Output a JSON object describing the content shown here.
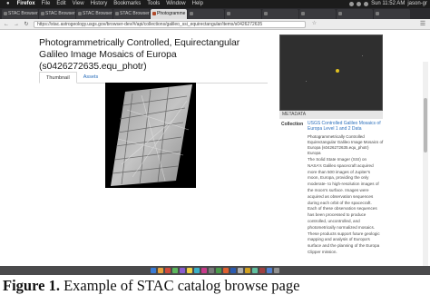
{
  "menubar": {
    "app_name": "Firefox",
    "items": [
      "File",
      "Edit",
      "View",
      "History",
      "Bookmarks",
      "Tools",
      "Window",
      "Help"
    ],
    "clock": "Sun 11:52 AM",
    "user": "jason-gr"
  },
  "browser_tabs": [
    {
      "label": "STAC Browser",
      "active": false
    },
    {
      "label": "STAC Browser",
      "active": false
    },
    {
      "label": "STAC Browser",
      "active": false
    },
    {
      "label": "STAC Browser",
      "active": false
    },
    {
      "label": "Photogramme",
      "active": true
    },
    {
      "label": "",
      "active": false
    },
    {
      "label": "",
      "active": false
    },
    {
      "label": "",
      "active": false
    },
    {
      "label": "",
      "active": false
    },
    {
      "label": "",
      "active": false
    },
    {
      "label": "",
      "active": false
    }
  ],
  "url": "https://stac.astrogeology.usgs.gov/browser-dev/#/api/collections/galileo_ssi_equirectangular/items/s0426272635",
  "page": {
    "title": "Photogrammetrically Controlled, Equirectangular Galileo Image Mosaics of Europa (s0426272635.equ_photr)",
    "tabs": [
      {
        "label": "Thumbnail",
        "active": true
      },
      {
        "label": "Assets",
        "active": false
      }
    ]
  },
  "sidebar": {
    "metadata_header": "METADATA",
    "collection_label": "Collection",
    "collection_link": "USGS Controlled Galileo Mosaics of Europa Level 1 and 2 Data",
    "desc_lines": [
      "Photogrammetrically Controlled",
      "Equirectangular Galileo Image Mosaics of",
      "Europa (s0426272635.equ_photr)",
      "Europa"
    ],
    "description": "The Solid State Imager (SSI) on NASA's Galileo spacecraft acquired more than 500 images of Jupiter's moon, Europa, providing the only moderate- to high-resolution images of the moon's surface. Images were acquired as observation sequences during each orbit of the spacecraft. Each of these observation sequences has been processed to produce controlled, uncontrolled, and photometrically normalized mosaics. These products support future geologic mapping and analysis of Europa's surface and the planning of the Europa Clipper mission."
  },
  "caption": {
    "prefix": "Figure 1.",
    "text": "Example of STAC catalog browse page"
  },
  "colors": {
    "link": "#2a6ebb",
    "menubar": "#1c1c1c",
    "tabbar": "#2a2a2e",
    "map_bg": "#2f2f2f",
    "map_footprint": "#e0c020"
  },
  "icons": [
    "apple-logo-icon",
    "back-arrow-icon",
    "forward-arrow-icon",
    "reload-icon",
    "bookmark-star-icon",
    "hamburger-menu-icon"
  ]
}
